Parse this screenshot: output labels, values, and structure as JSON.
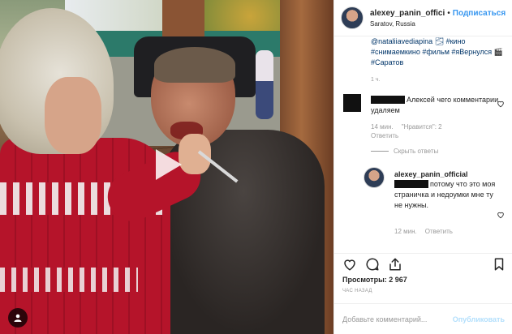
{
  "post": {
    "username": "alexey_panin_offici",
    "separator": "•",
    "follow_label": "Подписаться",
    "location": "Saratov, Russia"
  },
  "caption": {
    "text": "@nataliiavediapina 🌫 #кино #снимаемкино #фильм #яВернулся 🎬 #Саратов",
    "time": "1 ч."
  },
  "comments": [
    {
      "text": "Алексей чего комментарии удаляем",
      "time": "14 мин.",
      "likes": "\"Нравится\": 2",
      "reply_label": "Ответить",
      "hide_replies": "Скрыть ответы"
    },
    {
      "username": "alexey_panin_official",
      "text": "потому что это моя страничка и недоумки мне ту не нужны.",
      "time": "12 мин.",
      "reply_label": "Ответить"
    }
  ],
  "stats": {
    "views": "Просмотры: 2 967",
    "posted": "ЧАС НАЗАД"
  },
  "add_comment": {
    "placeholder": "Добавьте комментарий...",
    "publish_label": "Опубликовать"
  },
  "icons": {
    "play": "play-icon",
    "like": "heart-icon",
    "comment": "comment-icon",
    "share": "share-icon",
    "save": "bookmark-icon",
    "tag": "user-tag-icon"
  },
  "colors": {
    "accent": "#3897f0",
    "muted": "#999999",
    "hashtag": "#003569",
    "publish_disabled": "#b2dffc"
  }
}
